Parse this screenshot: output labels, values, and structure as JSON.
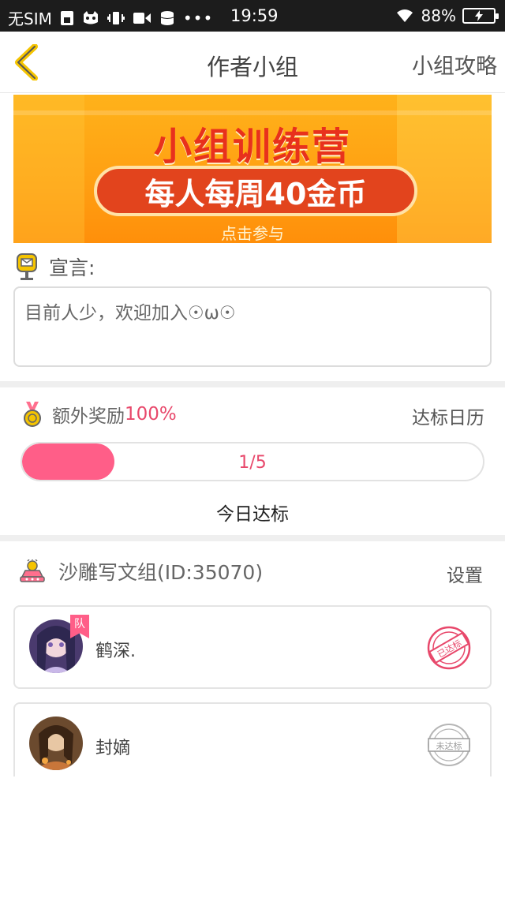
{
  "status_bar": {
    "carrier": "无SIM",
    "time": "19:59",
    "battery_pct": "88%",
    "icons": [
      "sim-card-icon",
      "cat-icon",
      "vibrate-icon",
      "video-icon",
      "database-icon",
      "more-dots-icon",
      "wifi-icon",
      "battery-icon"
    ]
  },
  "nav": {
    "title": "作者小组",
    "right_link": "小组攻略",
    "back_icon": "chevron-left-icon",
    "accent": "#f5c400"
  },
  "banner": {
    "title": "小组训练营",
    "pill_text": "每人每周40金币",
    "cta": "点击参与"
  },
  "declaration": {
    "label": "宣言:",
    "text": "目前人少，欢迎加入☉ω☉"
  },
  "reward": {
    "label": "额外奖励",
    "percent": "100%",
    "calendar_link": "达标日历",
    "progress_text": "1/5",
    "progress_fraction": 0.2,
    "today_label": "今日达标",
    "accent": "#ff5e88"
  },
  "group": {
    "name": "沙雕写文组(ID:35070)",
    "settings_link": "设置",
    "members": [
      {
        "name": "鹤深.",
        "badge": "队",
        "status": "已达标",
        "status_color": "#e8486b"
      },
      {
        "name": "封嫡",
        "badge": "",
        "status": "未达标",
        "status_color": "#9a9a9a"
      }
    ]
  }
}
